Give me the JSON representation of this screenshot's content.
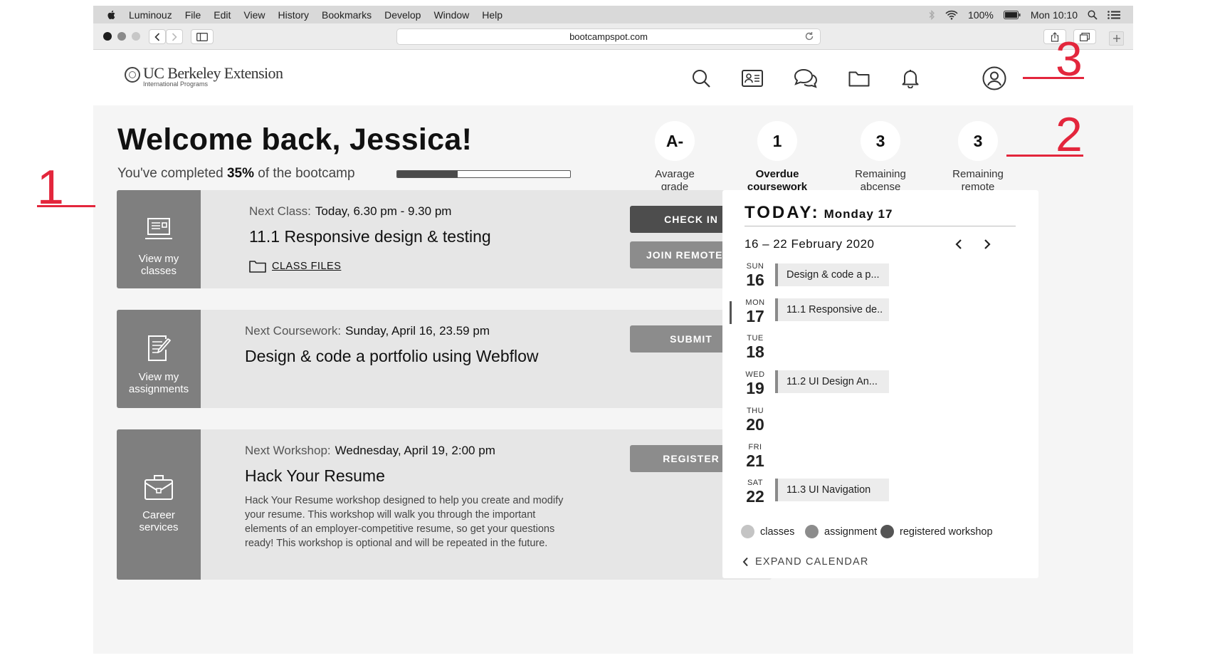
{
  "menubar": {
    "app": "Luminouz",
    "items": [
      "File",
      "Edit",
      "View",
      "History",
      "Bookmarks",
      "Develop",
      "Window",
      "Help"
    ],
    "battery": "100%",
    "clock": "Mon 10:10"
  },
  "browser": {
    "url": "bootcampspot.com"
  },
  "header": {
    "logo_brand": "UC Berkeley Extension",
    "logo_sub": "International Programs",
    "nav_icons": [
      "search-icon",
      "id-card-icon",
      "chat-icon",
      "folder-icon",
      "bell-icon",
      "profile-icon"
    ]
  },
  "welcome": {
    "title": "Welcome back, Jessica!",
    "progress_prefix": "You've completed",
    "progress_value": "35%",
    "progress_suffix": "of the bootcamp",
    "progress_fraction": 0.35
  },
  "stats": [
    {
      "value": "A-",
      "label_line1": "Avarage",
      "label_line2": "grade"
    },
    {
      "value": "1",
      "label_line1": "Overdue",
      "label_line2": "coursework"
    },
    {
      "value": "3",
      "label_line1": "Remaining",
      "label_line2": "abcense"
    },
    {
      "value": "3",
      "label_line1": "Remaining",
      "label_line2": "remote"
    }
  ],
  "cards": {
    "classes": {
      "side_line1": "View my",
      "side_line2": "classes",
      "meta_label": "Next Class:",
      "meta_value": "Today, 6.30 pm - 9.30 pm",
      "title": "11.1 Responsive design & testing",
      "files_link": "CLASS FILES",
      "checkin": "CHECK IN",
      "join": "JOIN REMOTELY"
    },
    "assignments": {
      "side_line1": "View my",
      "side_line2": "assignments",
      "meta_label": "Next Coursework:",
      "meta_value": "Sunday, April 16, 23.59 pm",
      "title": "Design & code a portfolio using Webflow",
      "submit": "SUBMIT"
    },
    "career": {
      "side_line1": "Career",
      "side_line2": "services",
      "meta_label": "Next Workshop:",
      "meta_value": "Wednesday, April 19, 2:00 pm",
      "title": "Hack Your Resume",
      "description": "Hack Your Resume workshop designed to help you create and modify your resume. This workshop will walk you through the important elements of an employer-competitive resume, so get your questions ready! This workshop is optional and will be repeated in the future.",
      "register": "REGISTER"
    }
  },
  "calendar": {
    "today_label": "TODAY:",
    "today_value": "Monday 17",
    "range": "16 – 22 February 2020",
    "days": [
      {
        "dow": "SUN",
        "num": "16",
        "event": "Design & code a p..."
      },
      {
        "dow": "MON",
        "num": "17",
        "event": "11.1 Responsive de.."
      },
      {
        "dow": "TUE",
        "num": "18",
        "event": ""
      },
      {
        "dow": "WED",
        "num": "19",
        "event": "11.2 UI Design An..."
      },
      {
        "dow": "THU",
        "num": "20",
        "event": ""
      },
      {
        "dow": "FRI",
        "num": "21",
        "event": ""
      },
      {
        "dow": "SAT",
        "num": "22",
        "event": "11.3 UI Navigation"
      }
    ],
    "legend": [
      {
        "label": "classes",
        "color": "#c4c4c4"
      },
      {
        "label": "assignment",
        "color": "#8c8c8c"
      },
      {
        "label": "registered workshop",
        "color": "#555555"
      }
    ],
    "expand": "EXPAND CALENDAR"
  },
  "annotations": [
    "1",
    "2",
    "3"
  ]
}
